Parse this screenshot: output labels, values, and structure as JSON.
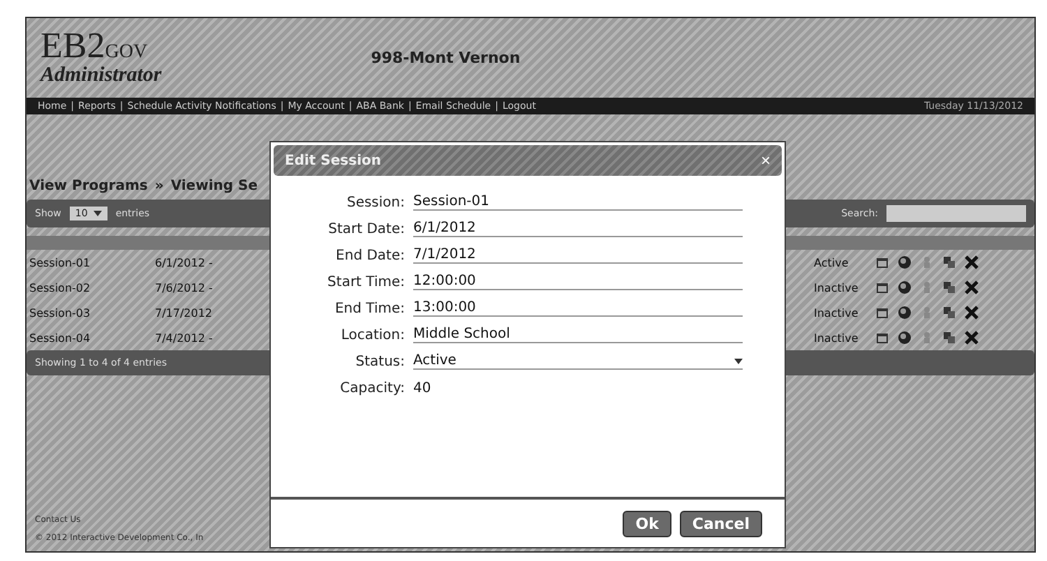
{
  "header": {
    "logo": "EB2",
    "logo_suffix": "GOV",
    "subtitle": "Administrator",
    "site": "998-Mont Vernon"
  },
  "nav": {
    "links": [
      "Home",
      "Reports",
      "Schedule Activity Notifications",
      "My Account",
      "ABA Bank",
      "Email Schedule",
      "Logout"
    ],
    "separator": "|",
    "date": "Tuesday 11/13/2012"
  },
  "breadcrumb": {
    "items": [
      "View Programs",
      "Viewing Se"
    ],
    "separator": "»"
  },
  "table": {
    "show_label": "Show",
    "page_size": "10",
    "entries_label": "entries",
    "search_label": "Search:",
    "rows": [
      {
        "session": "Session-01",
        "date": "6/1/2012 -",
        "status": "Active"
      },
      {
        "session": "Session-02",
        "date": "7/6/2012 -",
        "status": "Inactive"
      },
      {
        "session": "Session-03",
        "date": "7/17/2012",
        "status": "Inactive"
      },
      {
        "session": "Session-04",
        "date": "7/4/2012 -",
        "status": "Inactive"
      }
    ],
    "info": "Showing 1 to 4 of 4 entries"
  },
  "footer": {
    "contact": "Contact Us",
    "copyright": "© 2012 Interactive Development Co., In"
  },
  "dialog": {
    "title": "Edit Session",
    "close": "×",
    "fields": [
      {
        "label": "Session:",
        "value": "Session-01",
        "kind": "text"
      },
      {
        "label": "Start Date:",
        "value": "6/1/2012",
        "kind": "text"
      },
      {
        "label": "End Date:",
        "value": "7/1/2012",
        "kind": "text"
      },
      {
        "label": "Start Time:",
        "value": "12:00:00",
        "kind": "text"
      },
      {
        "label": "End Time:",
        "value": "13:00:00",
        "kind": "text"
      },
      {
        "label": "Location:",
        "value": "Middle School",
        "kind": "text"
      },
      {
        "label": "Status:",
        "value": "Active",
        "kind": "select"
      },
      {
        "label": "Capacity:",
        "value": "40",
        "kind": "plain"
      }
    ],
    "buttons": [
      "Ok",
      "Cancel"
    ]
  }
}
